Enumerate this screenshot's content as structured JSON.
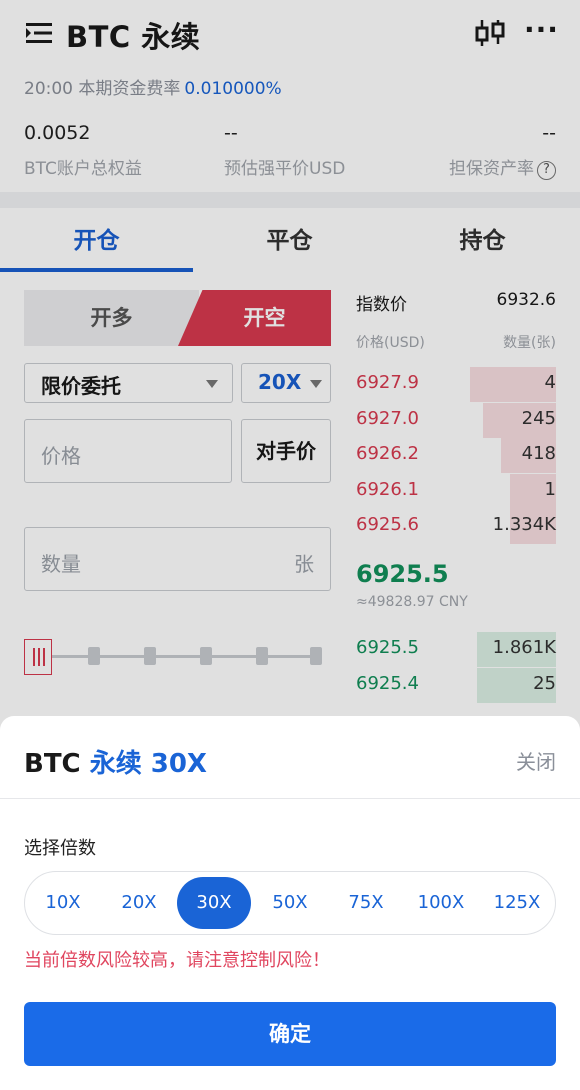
{
  "header": {
    "title": "BTC 永续"
  },
  "funding": {
    "label": "20:00 本期资金费率",
    "rate": "0.010000%"
  },
  "stats": [
    {
      "value": "0.0052",
      "label": "BTC账户总权益"
    },
    {
      "value": "--",
      "label": "预估强平价USD"
    },
    {
      "value": "--",
      "label": "担保资产率"
    }
  ],
  "tabs": [
    {
      "label": "开仓",
      "active": true
    },
    {
      "label": "平仓",
      "active": false
    },
    {
      "label": "持仓",
      "active": false
    }
  ],
  "order": {
    "long_label": "开多",
    "short_label": "开空",
    "type_value": "限价委托",
    "leverage_value": "20X",
    "price_placeholder": "价格",
    "counter_price_label": "对手价",
    "qty_placeholder": "数量",
    "qty_unit": "张",
    "slider_value_percent": 0
  },
  "book": {
    "index_label": "指数价",
    "index_value": "6932.6",
    "col_price": "价格(USD)",
    "col_qty": "数量(张)",
    "asks": [
      {
        "price": "6927.9",
        "qty": "4",
        "depth": 0.65
      },
      {
        "price": "6927.0",
        "qty": "245",
        "depth": 0.55
      },
      {
        "price": "6926.2",
        "qty": "418",
        "depth": 0.42
      },
      {
        "price": "6926.1",
        "qty": "1",
        "depth": 0.35
      },
      {
        "price": "6925.6",
        "qty": "1.334K",
        "depth": 0.35
      }
    ],
    "last_price": "6925.5",
    "last_cny": "≈49828.97 CNY",
    "bids": [
      {
        "price": "6925.5",
        "qty": "1.861K",
        "depth": 0.6
      },
      {
        "price": "6925.4",
        "qty": "25",
        "depth": 0.6
      }
    ]
  },
  "sheet": {
    "title_prefix": "BTC",
    "title_accent": "永续 30X",
    "close_label": "关闭",
    "choose_label": "选择倍数",
    "options": [
      "10X",
      "20X",
      "30X",
      "50X",
      "75X",
      "100X",
      "125X"
    ],
    "selected": "30X",
    "warning": "当前倍数风险较高，请注意控制风险！",
    "confirm_label": "确定"
  },
  "colors": {
    "accent": "#1a64d6",
    "sell": "#d83a4f",
    "buy": "#12905a"
  }
}
